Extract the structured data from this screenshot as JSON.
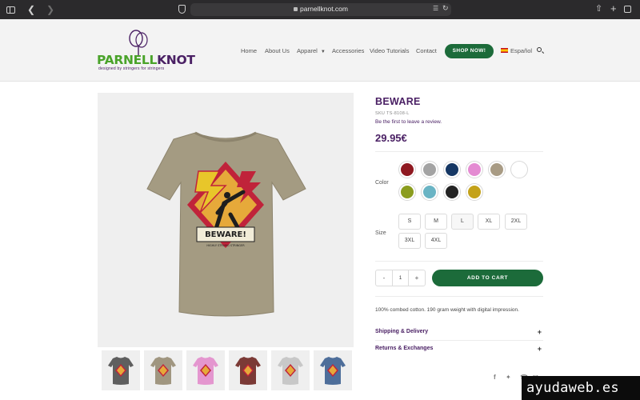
{
  "browser": {
    "url": "parnellknot.com"
  },
  "brand": {
    "name_part1": "PARNELL",
    "name_part2": "KNOT",
    "tagline": "designed by stringers for stringers",
    "purple": "#4a2064",
    "green": "#4aa32a",
    "button_green": "#1c6b3a"
  },
  "nav": {
    "items": [
      "Home",
      "About Us",
      "Apparel",
      "Accessories",
      "Video Tutorials",
      "Contact"
    ],
    "shop_button": "SHOP NOW!",
    "language": "Español"
  },
  "product": {
    "title": "BEWARE",
    "sku": "SKU TS-8108-L",
    "review_link": "Be the first to leave a review.",
    "price": "29.95€",
    "color_label": "Color",
    "colors": [
      "#8e1820",
      "#a3a3a3",
      "#153764",
      "#e48bd2",
      "#a89b84",
      "#ffffff",
      "#8a9c1e",
      "#6ab4c4",
      "#232323",
      "#c4a21a"
    ],
    "size_label": "Size",
    "sizes": [
      "S",
      "M",
      "L",
      "XL",
      "2XL",
      "3XL",
      "4XL"
    ],
    "selected_size": "L",
    "qty_minus": "-",
    "quantity": "1",
    "qty_plus": "+",
    "add_to_cart": "ADD TO CART",
    "description": "100% combed cotton. 190 gram weight with digital impression.",
    "accordions": [
      "Shipping & Delivery",
      "Returns & Exchanges"
    ],
    "shirt_main_color": "#a49b82",
    "graphic_text": "BEWARE!",
    "graphic_subtext": "HIGHLY STRUNG STRINGER"
  },
  "thumbnails": [
    "#5f5f5f",
    "#a09680",
    "#e496cf",
    "#7b3a36",
    "#c8c8c8",
    "#4e6e9a"
  ],
  "share_icons": [
    "facebook-icon",
    "twitter-icon",
    "whatsapp-icon",
    "email-icon"
  ],
  "watermark": "ayudaweb.es"
}
